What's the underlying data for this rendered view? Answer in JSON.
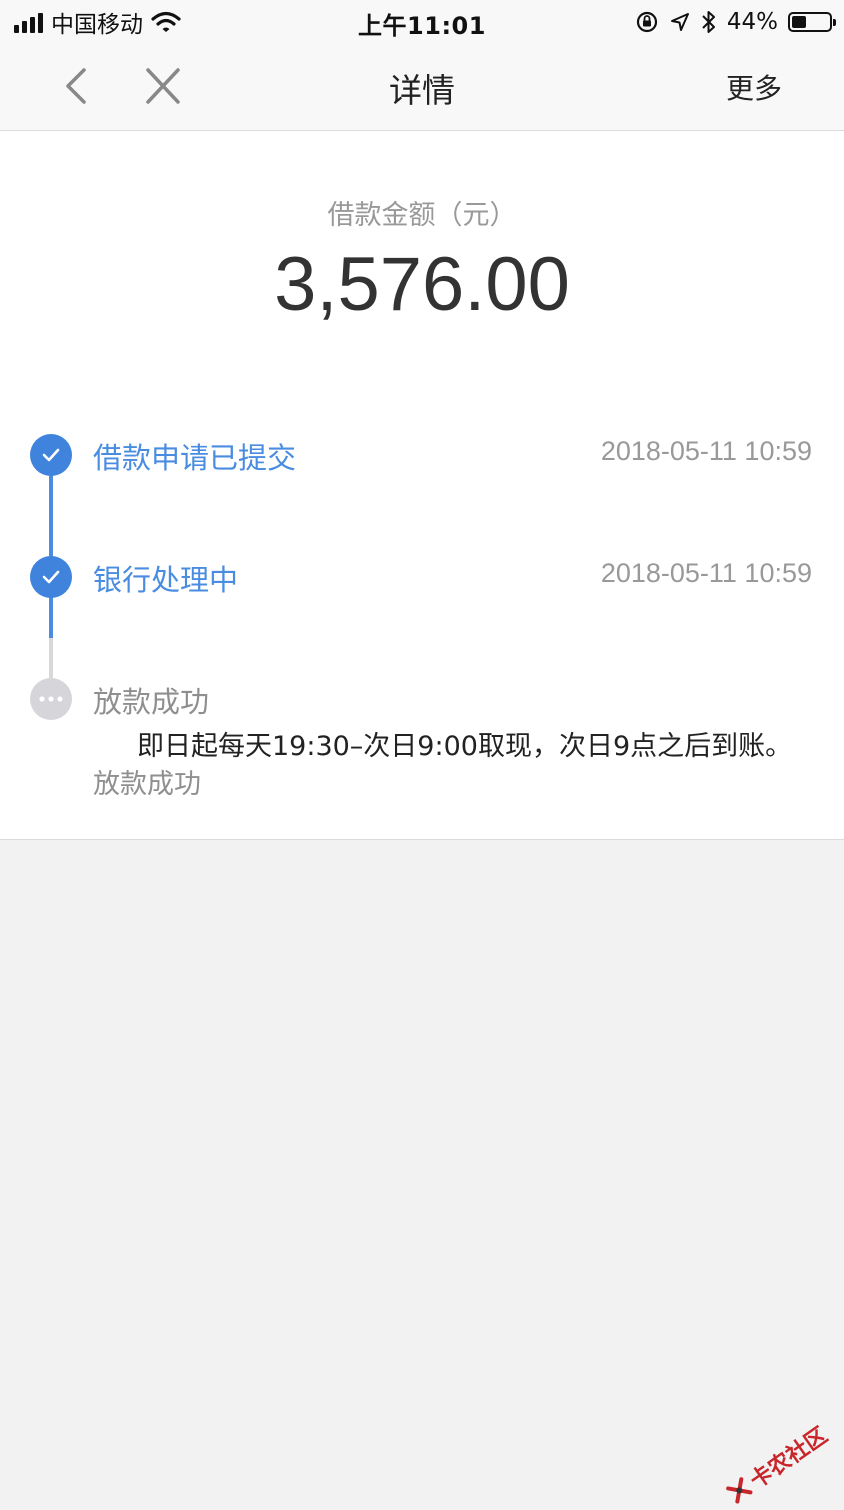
{
  "status_bar": {
    "carrier": "中国移动",
    "time": "上午11:01",
    "battery_percent_text": "44%",
    "battery_level": 0.44
  },
  "nav": {
    "title": "详情",
    "more_label": "更多",
    "back_icon": "chevron-left-icon",
    "close_icon": "close-icon"
  },
  "summary": {
    "amount_label": "借款金额（元）",
    "amount": "3,576.00"
  },
  "timeline": [
    {
      "title": "借款申请已提交",
      "time": "2018-05-11 10:59",
      "status": "done"
    },
    {
      "title": "银行处理中",
      "time": "2018-05-11 10:59",
      "status": "done"
    },
    {
      "title": "放款成功",
      "note": "即日起每天19:30–次日9:00取现，次日9点之后到账。",
      "sub": "放款成功",
      "status": "pending"
    }
  ],
  "watermark": {
    "text": "卡农社区"
  },
  "colors": {
    "accent": "#3f83dc",
    "pending": "#d5d5da",
    "muted_text": "#999999"
  }
}
